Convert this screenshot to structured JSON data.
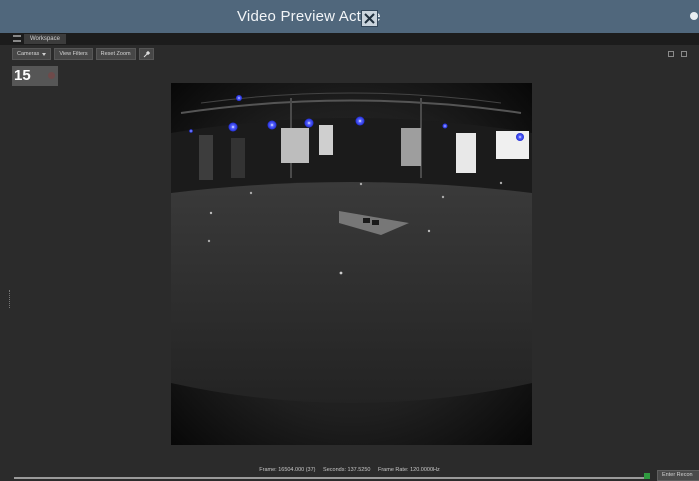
{
  "window": {
    "title": "Video Preview Active",
    "close_icon": "close-icon"
  },
  "workspace": {
    "tab_label": "Workspace",
    "icon": "menu-icon"
  },
  "toolbar": {
    "cameras_label": "Cameras",
    "view_filters_label": "View Filters",
    "reset_zoom_label": "Reset Zoom",
    "pin_icon": "pin-icon"
  },
  "camera": {
    "number": "15",
    "record_indicator": "record-icon"
  },
  "status": {
    "frame": "Frame: 16504.000 (37)",
    "seconds": "Seconds: 137.5250",
    "frame_rate": "Frame Rate: 120.0000Hz"
  },
  "enter_button_label": "Enter Recon",
  "colors": {
    "title_bar": "#50677c",
    "marker": "#2f3cff",
    "timeline_handle": "#2f9a3f",
    "background": "#2b2b2b"
  }
}
